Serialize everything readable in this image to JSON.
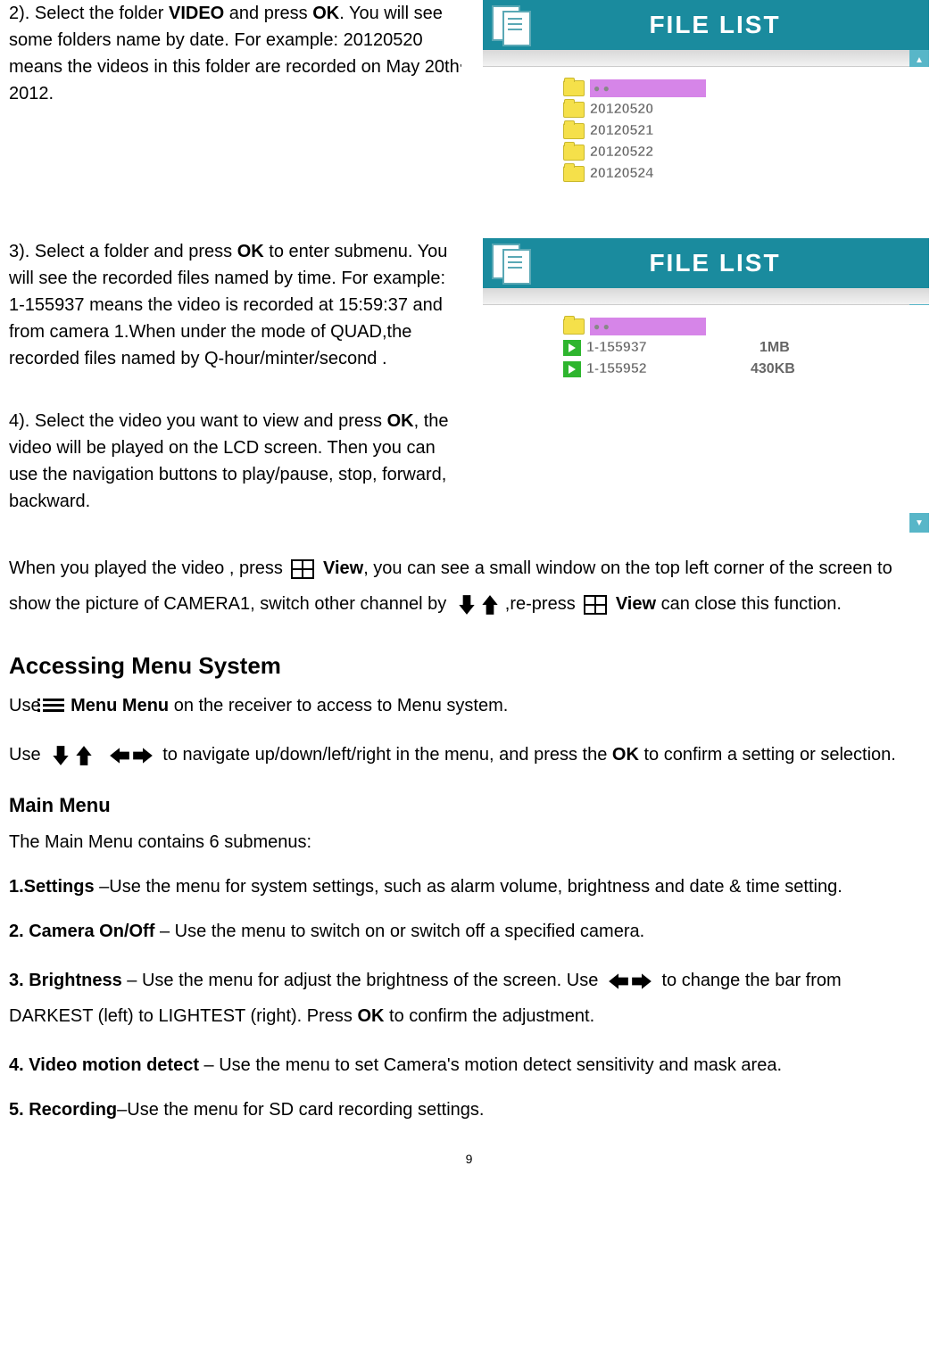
{
  "step2": {
    "pre": "2). Select the folder ",
    "bold1": "VIDEO",
    "mid1": " and press ",
    "bold2": "OK",
    "post": ". You will see some folders name by date. For example: 20120520 means the videos in this folder are recorded on May 20th"
  },
  "step2_sup": ",",
  "step2_tail": " 2012.",
  "panel1": {
    "title": "FILE LIST",
    "folders": [
      "20120520",
      "20120521",
      "20120522",
      "20120524"
    ]
  },
  "panel2": {
    "title": "FILE LIST",
    "files": [
      {
        "name": "1-155937",
        "size": "1MB"
      },
      {
        "name": "1-155952",
        "size": "430KB"
      }
    ]
  },
  "step3": {
    "pre": "3). Select a folder and press ",
    "bold1": "OK",
    "post": " to enter submenu. You will see the recorded files named by time. For example: 1-155937 means the video is recorded at 15:59:37 and from camera 1.When under the mode of QUAD,the recorded files named by Q-hour/minter/second ."
  },
  "step4": {
    "pre": "4). Select the video you want to view and press ",
    "bold1": "OK",
    "post": ", the video will be played on the LCD screen. Then you can use the navigation buttons to play/pause, stop, forward, backward."
  },
  "view_para": {
    "t1": "When you played the video , press ",
    "bview1": "View",
    "t2": ", you can see a small window on the top left corner of the screen to show the picture of CAMERA1, switch other channel by ",
    "t3": ",re-press ",
    "bview2": "View",
    "t4": " can close this function."
  },
  "h_accessing": "Accessing Menu System",
  "menu_line": {
    "t1": "Use",
    "b1": "Menu Menu",
    "t2": " on the receiver to access to Menu system."
  },
  "nav_line": {
    "t1": "Use ",
    "t2": " to navigate up/down/left/right in the menu, and press the ",
    "b1": "OK",
    "t3": " to confirm a setting or selection."
  },
  "h_main": "Main Menu",
  "main_intro": "The Main Menu contains 6 submenus:",
  "m1": {
    "b": "1.Settings ",
    "t": "–Use the menu for system settings, such as alarm volume, brightness and date & time setting."
  },
  "m2": {
    "b": "2. Camera On/Off",
    "t": " – Use the menu to switch on or switch off a specified camera."
  },
  "m3": {
    "b": "3. Brightness",
    "t1": " – Use the menu for adjust the brightness of the screen. Use ",
    "t2": " to change the bar from DARKEST (left) to LIGHTEST (right). Press ",
    "bok": "OK",
    "t3": " to confirm the adjustment."
  },
  "m4": {
    "b": "4. Video motion detect",
    "t": " – Use the menu to set Camera's motion detect sensitivity and mask area."
  },
  "m5": {
    "b": "5. Recording",
    "t": "–Use the menu for SD card recording settings."
  },
  "page_num": "9"
}
